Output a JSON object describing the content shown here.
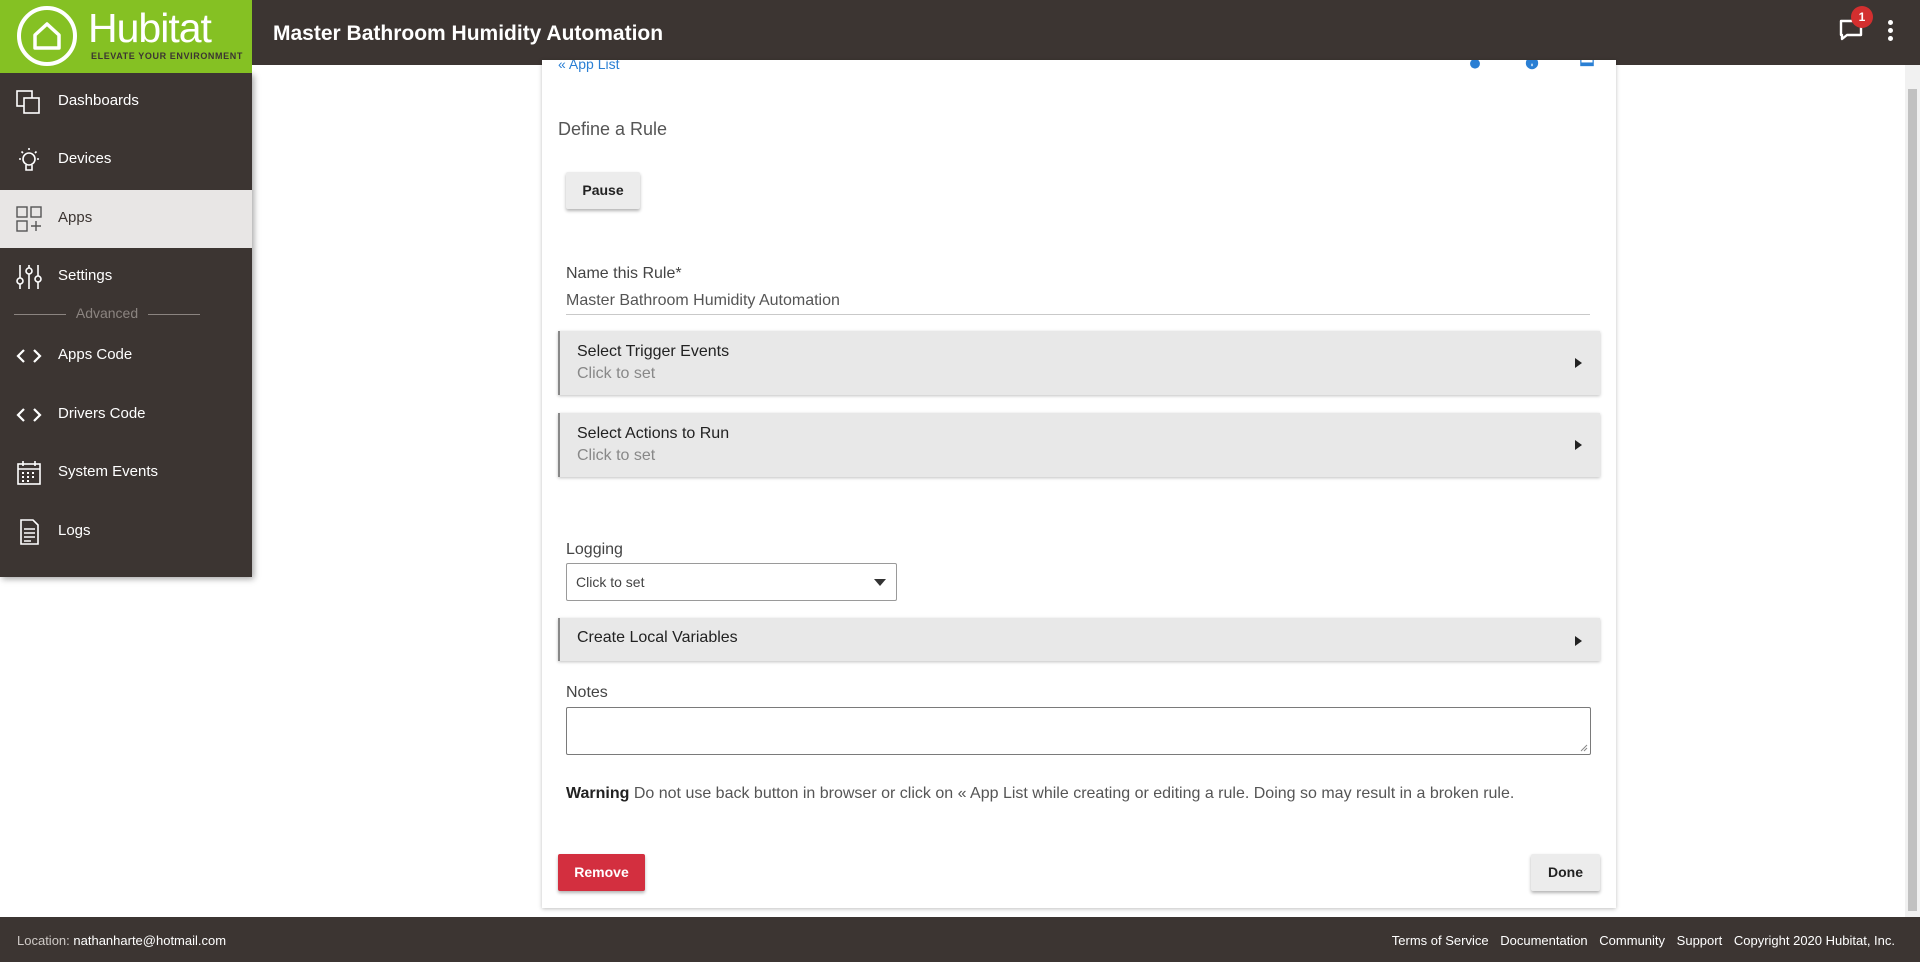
{
  "header": {
    "logo_name": "Hubitat",
    "logo_tagline": "ELEVATE YOUR ENVIRONMENT",
    "title": "Master Bathroom Humidity Automation",
    "notification_count": "1"
  },
  "sidebar": {
    "items": [
      {
        "label": "Dashboards",
        "icon": "dashboards-icon"
      },
      {
        "label": "Devices",
        "icon": "lightbulb-icon"
      },
      {
        "label": "Apps",
        "icon": "apps-grid-icon",
        "active": true
      },
      {
        "label": "Settings",
        "icon": "sliders-icon"
      },
      {
        "label": "Apps Code",
        "icon": "code-icon"
      },
      {
        "label": "Drivers Code",
        "icon": "code-icon"
      },
      {
        "label": "System Events",
        "icon": "calendar-icon"
      },
      {
        "label": "Logs",
        "icon": "document-icon"
      }
    ],
    "advanced_label": "Advanced"
  },
  "main": {
    "app_list_link": "« App List",
    "heading": "Define a Rule",
    "pause_label": "Pause",
    "name_label": "Name this Rule*",
    "name_value": "Master Bathroom Humidity Automation",
    "sections": [
      {
        "title": "Select Trigger Events",
        "subtitle": "Click to set"
      },
      {
        "title": "Select Actions to Run",
        "subtitle": "Click to set"
      }
    ],
    "logging_label": "Logging",
    "logging_value": "Click to set",
    "local_variables_title": "Create Local Variables",
    "notes_label": "Notes",
    "warning_bold": "Warning",
    "warning_text": " Do not use back button in browser or click on « App List while creating or editing a rule. Doing so may result in a broken rule.",
    "remove_label": "Remove",
    "done_label": "Done"
  },
  "footer": {
    "location_label": "Location:",
    "location_value": "nathanharte@hotmail.com",
    "links": [
      "Terms of Service",
      "Documentation",
      "Community",
      "Support",
      "Copyright 2020 Hubitat, Inc."
    ]
  },
  "colors": {
    "brand_green": "#85c123",
    "chrome_dark": "#3c3532",
    "remove_red": "#d32f3f",
    "link_blue": "#2a7fd4"
  }
}
